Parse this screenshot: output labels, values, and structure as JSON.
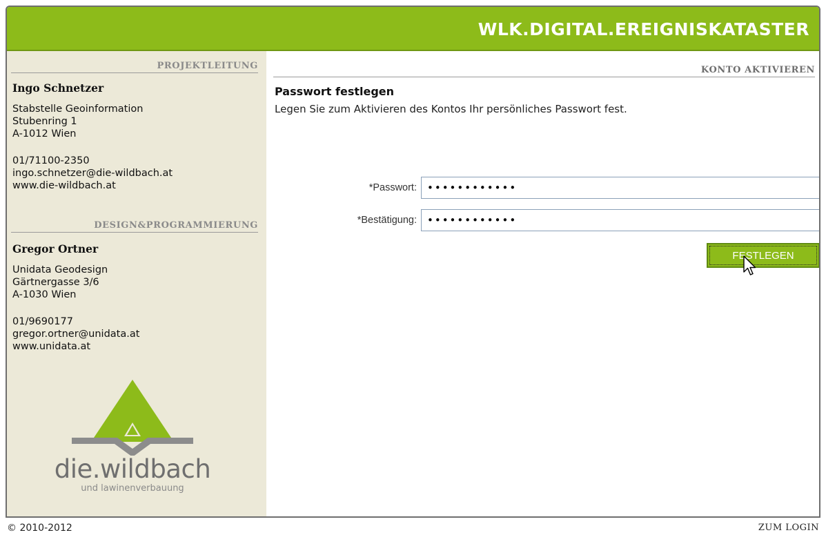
{
  "header": {
    "title": "WLK.DIGITAL.EREIGNISKATASTER"
  },
  "sidebar": {
    "project_lead": {
      "section_title": "PROJEKTLEITUNG",
      "name": "Ingo Schnetzer",
      "address": "Stabstelle Geoinformation\nStubenring 1\nA-1012 Wien",
      "contact": "01/71100-2350\ningo.schnetzer@die-wildbach.at\nwww.die-wildbach.at"
    },
    "design": {
      "section_title": "DESIGN&PROGRAMMIERUNG",
      "name": "Gregor Ortner",
      "address": "Unidata Geodesign\nGärtnergasse 3/6\nA-1030 Wien",
      "contact": "01/9690177\ngregor.ortner@unidata.at\nwww.unidata.at"
    },
    "logo": {
      "word": "die.wildbach",
      "subtitle": "und lawinenverbauung"
    }
  },
  "main": {
    "section_title": "KONTO AKTIVIEREN",
    "heading": "Passwort festlegen",
    "description": "Legen Sie zum Aktivieren des Kontos Ihr persönliches Passwort fest.",
    "form": {
      "password_label": "*Passwort:",
      "password_value": "••••••••••••",
      "confirm_label": "*Bestätigung:",
      "confirm_value": "••••••••••••",
      "submit_label": "FESTLEGEN"
    }
  },
  "footer": {
    "copyright": "© 2010-2012",
    "login_link": "ZUM LOGIN"
  },
  "colors": {
    "brand_green": "#8dbb1a",
    "sidebar_bg": "#ece9d8",
    "logo_grey": "#8c8c8c"
  }
}
